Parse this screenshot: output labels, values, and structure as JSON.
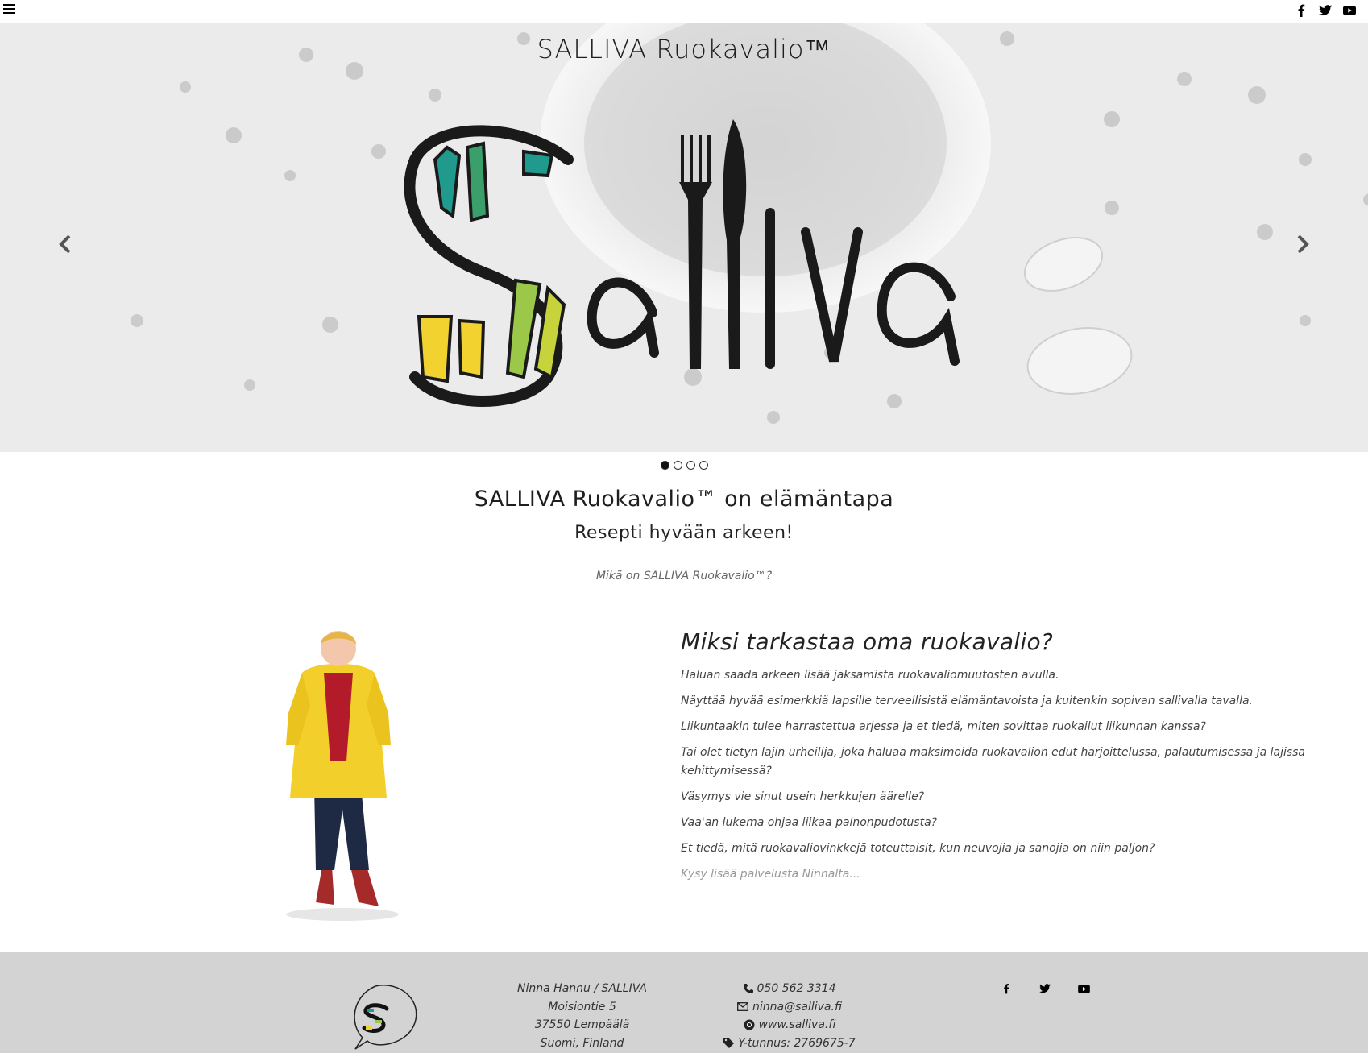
{
  "topbar": {
    "menu_icon": "hamburger-menu-icon",
    "social_icons": [
      "facebook-icon",
      "twitter-icon",
      "youtube-icon"
    ]
  },
  "hero": {
    "title": "SALLIVA Ruokavalio™",
    "logo_text": "Salliva",
    "slides_total": 4,
    "active_slide": 1
  },
  "intro": {
    "heading": "SALLIVA Ruokavalio™ on elämäntapa",
    "subheading": "Resepti hyvään arkeen!",
    "link": "Mikä on SALLIVA Ruokavalio™?"
  },
  "why": {
    "heading": "Miksi tarkastaa oma ruokavalio?",
    "paragraphs": [
      "Haluan saada arkeen lisää jaksamista ruokavaliomuutosten avulla.",
      "Näyttää hyvää esimerkkiä lapsille terveellisistä elämäntavoista ja kuitenkin sopivan sallivalla tavalla.",
      "Liikuntaakin tulee harrastettua arjessa ja et tiedä, miten sovittaa ruokailut liikunnan kanssa?",
      "Tai olet tietyn lajin urheilija, joka haluaa maksimoida ruokavalion edut harjoittelussa, palautumisessa ja lajissa kehittymisessä?",
      "Väsymys vie sinut usein herkkujen äärelle?",
      "Vaa'an lukema ohjaa liikaa painonpudotusta?",
      "Et tiedä, mitä ruokavaliovinkkejä toteuttaisit, kun neuvojia ja sanojia on niin paljon?"
    ],
    "link": "Kysy lisää palvelusta Ninnalta..."
  },
  "footer": {
    "address": [
      "Ninna Hannu / SALLIVA",
      "Moisiontie 5",
      "37550 Lempäälä",
      "Suomi, Finland"
    ],
    "phone": "050 562 3314",
    "email": "ninna@salliva.fi",
    "website": "www.salliva.fi",
    "business_id": "Y-tunnus: 2769675-7",
    "colors": {
      "background": "#d3d3d3",
      "teal": "#1f9a8c",
      "green": "#4cb050",
      "yellow": "#f2d22e"
    }
  }
}
